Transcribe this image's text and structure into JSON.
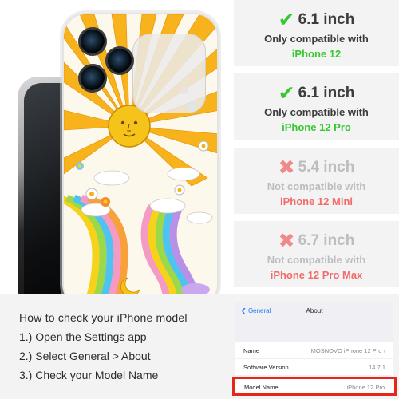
{
  "compatibility": [
    {
      "mark": "check-icon",
      "size": "6.1 inch",
      "status": "Only compatible with",
      "model": "iPhone 12"
    },
    {
      "mark": "check-icon",
      "size": "6.1 inch",
      "status": "Only compatible with",
      "model": "iPhone 12 Pro"
    },
    {
      "mark": "cross-icon",
      "size": "5.4 inch",
      "status": "Not compatible with",
      "model": "iPhone 12 Mini"
    },
    {
      "mark": "cross-icon",
      "size": "6.7 inch",
      "status": "Not compatible with",
      "model": "iPhone 12 Pro Max"
    }
  ],
  "symbols": {
    "check": "✔",
    "cross": "✖"
  },
  "colors": {
    "compatible": "#35c92f",
    "incompatible_model": "#f26b6b",
    "incompatible_mark": "#f08a8a",
    "highlight": "#e8251d",
    "ios_link": "#1a7cf5"
  },
  "instructions": {
    "title": "How to check your iPhone model",
    "steps": [
      "1.) Open the Settings app",
      "2.) Select General > About",
      "3.) Check your Model Name"
    ]
  },
  "settings_screen": {
    "back_label": "General",
    "title": "About",
    "rows": [
      {
        "label": "Name",
        "value": "MOSNOVO iPhone 12 Pro"
      },
      {
        "label": "Software Version",
        "value": "14.7.1"
      },
      {
        "label": "Model Name",
        "value": "iPhone 12 Pro"
      }
    ]
  }
}
